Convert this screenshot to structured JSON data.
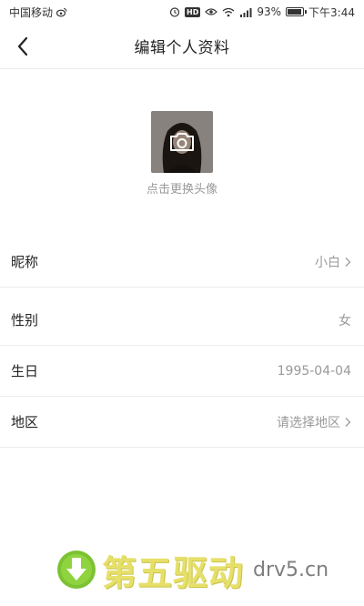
{
  "status_bar": {
    "carrier": "中国移动",
    "battery": "93%",
    "time": "下午3:44",
    "hd_label": "HD",
    "icons": [
      "weibo-icon",
      "alarm-icon",
      "hd-icon",
      "eye-icon",
      "wifi-icon",
      "signal-icon",
      "battery-icon"
    ],
    "battery_level": 0.93
  },
  "nav": {
    "title": "编辑个人资料",
    "back_icon": "chevron-left-icon"
  },
  "avatar": {
    "hint": "点击更换头像",
    "overlay_icon": "camera-icon"
  },
  "profile_rows": [
    {
      "label": "昵称",
      "value": "小白",
      "has_chevron": true
    },
    {
      "label": "性别",
      "value": "女",
      "has_chevron": false
    },
    {
      "label": "生日",
      "value": "1995-04-04",
      "has_chevron": false
    },
    {
      "label": "地区",
      "value": "请选择地区",
      "has_chevron": true
    }
  ],
  "watermark": {
    "cn": "第五驱动",
    "url": "drv5.cn",
    "icon": "download-arrow-icon"
  },
  "colors": {
    "divider": "#ececec",
    "secondary_text": "#999999",
    "watermark_green": "#7cc232",
    "watermark_yellow": "#e6e06a"
  }
}
